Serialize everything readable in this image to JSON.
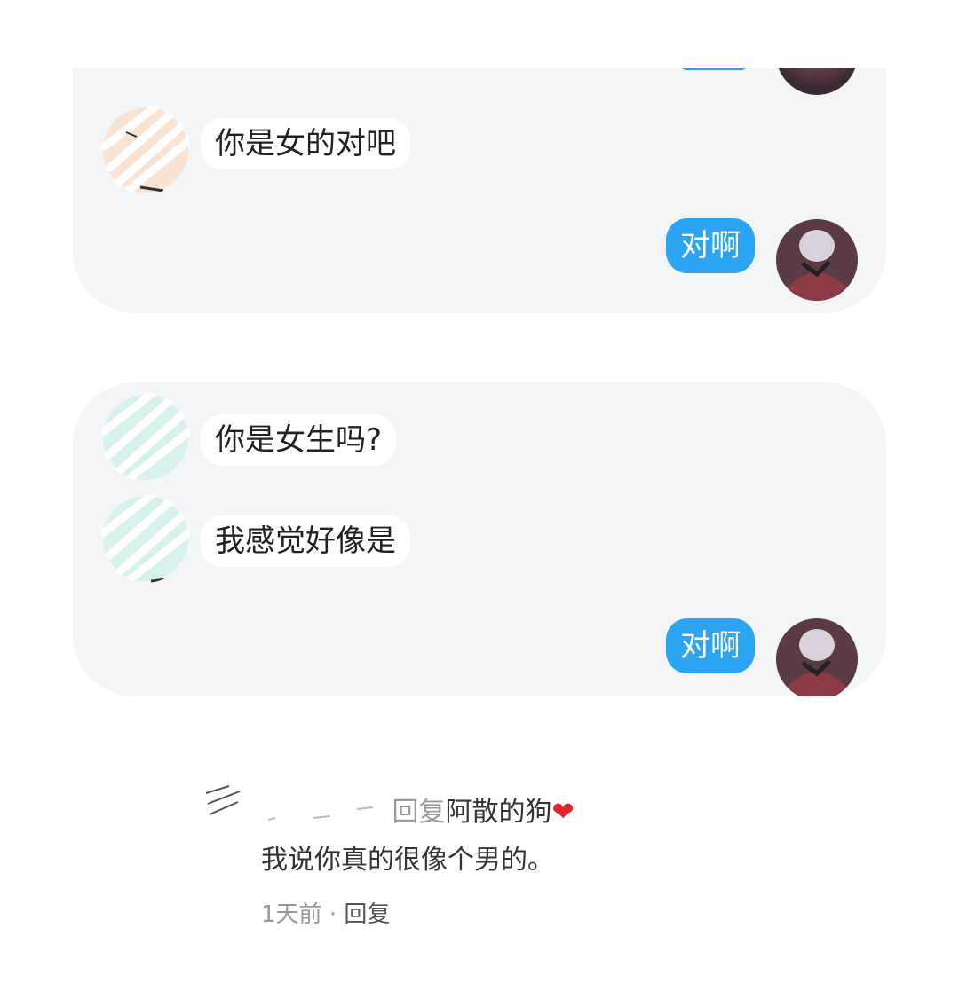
{
  "conversations": [
    {
      "left_messages": [
        "你是女的对吧"
      ],
      "right_messages": [
        "对啊"
      ]
    },
    {
      "left_messages": [
        "你是女生吗?",
        "我感觉好像是"
      ],
      "right_messages": [
        "对啊"
      ]
    }
  ],
  "comment": {
    "reply_word": "回复",
    "reply_target": "阿散的狗",
    "heart_icon": "heart-icon",
    "body": "我说你真的很像个男的。",
    "time": "1天前",
    "separator": "·",
    "reply_button": "回复"
  },
  "colors": {
    "card_bg": "#f4f5f7",
    "self_bubble": "#2ba4f3",
    "heart": "#e0242f"
  }
}
